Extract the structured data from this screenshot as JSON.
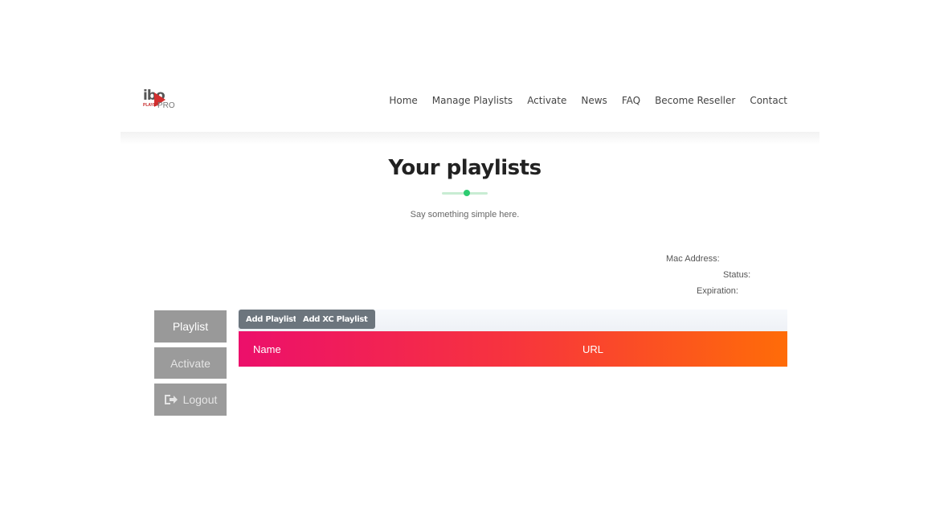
{
  "logo": {
    "mark": "ibo",
    "tag": "PLAYER",
    "suffix": "PRO"
  },
  "nav": {
    "items": [
      "Home",
      "Manage Playlists",
      "Activate",
      "News",
      "FAQ",
      "Become Reseller",
      "Contact"
    ]
  },
  "page": {
    "title": "Your playlists",
    "subtitle": "Say something simple here."
  },
  "device": {
    "mac_label": "Mac Address:",
    "status_label": "Status:",
    "expiration_label": "Expiration:"
  },
  "sidebar": {
    "playlist_label": "Playlist",
    "activate_label": "Activate",
    "logout_label": "Logout"
  },
  "toolbar": {
    "add_playlist_label": "Add Playlist",
    "add_xc_playlist_label": "Add XC Playlist"
  },
  "table": {
    "columns": [
      "Name",
      "URL"
    ]
  },
  "colors": {
    "accent_green": "#2ecc71",
    "table_gradient_start": "#ec0f6b",
    "table_gradient_end": "#ff6c08",
    "button_gray": "#999999"
  }
}
